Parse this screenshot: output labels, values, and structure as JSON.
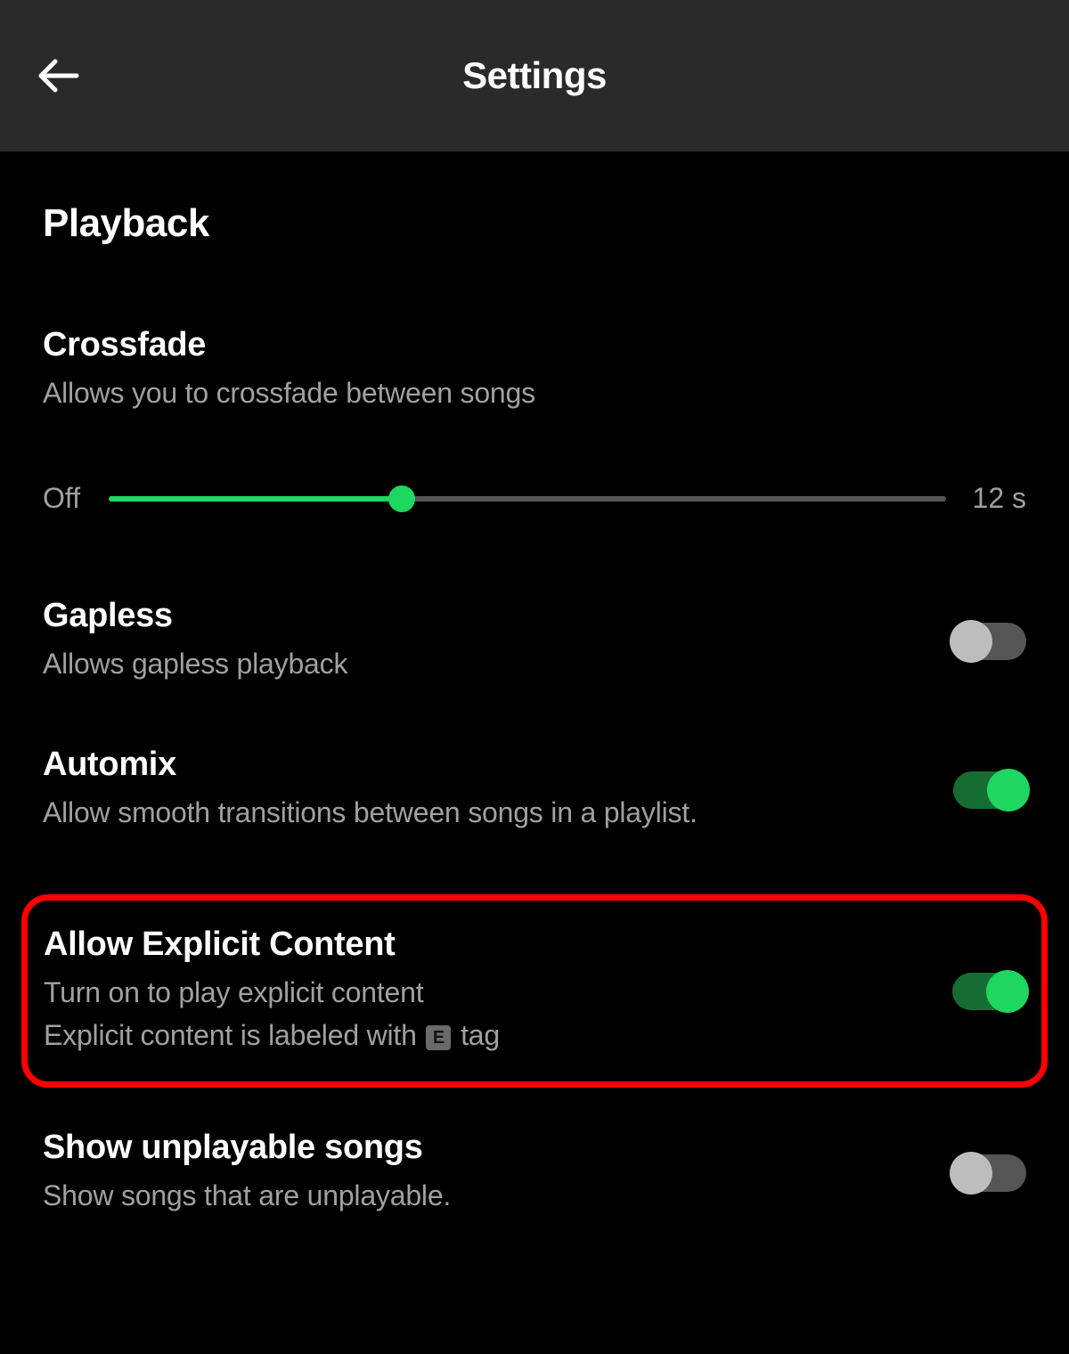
{
  "header": {
    "title": "Settings"
  },
  "section": {
    "title": "Playback"
  },
  "crossfade": {
    "title": "Crossfade",
    "desc": "Allows you to crossfade between songs",
    "left_label": "Off",
    "right_label": "12 s",
    "percent": 35
  },
  "gapless": {
    "title": "Gapless",
    "desc": "Allows gapless playback",
    "state": "off"
  },
  "automix": {
    "title": "Automix",
    "desc": "Allow smooth transitions between songs in a playlist.",
    "state": "on"
  },
  "explicit": {
    "title": "Allow Explicit Content",
    "desc1": "Turn on to play explicit content",
    "desc2_before": "Explicit content is labeled with ",
    "desc2_e": "E",
    "desc2_after": " tag",
    "state": "on"
  },
  "unplayable": {
    "title": "Show unplayable songs",
    "desc": "Show songs that are unplayable.",
    "state": "off"
  }
}
